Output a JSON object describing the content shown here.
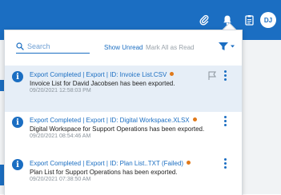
{
  "header": {
    "user_initials": "DJ",
    "icons": [
      "paperclip-icon",
      "bell-icon",
      "clipboard-icon"
    ]
  },
  "notifications_panel": {
    "search": {
      "placeholder": "Search",
      "value": ""
    },
    "show_unread_label": "Show Unread",
    "mark_all_read_label": "Mark All as Read",
    "filter_icon": "filter-icon",
    "items": [
      {
        "title": "Export Completed | Export | ID: Invoice List.CSV",
        "message": "Invoice List for David Jacobsen has been exported.",
        "timestamp": "09/20/2021 12:58:03 PM",
        "unread": true,
        "selected": true
      },
      {
        "title": "Export Completed | Export | ID: Digital Workspace.XLSX",
        "message": "Digital Workspace for Support Operations has been exported.",
        "timestamp": "09/20/2021 08:54:46 AM",
        "unread": true,
        "selected": false
      },
      {
        "title": "Export Completed | Export | ID: Plan List..TXT (Failed)",
        "message": "Plan List for Support Operations has been exported.",
        "timestamp": "09/20/2021 07:38:50 AM",
        "unread": true,
        "selected": false
      }
    ]
  },
  "colors": {
    "brand": "#1b6ec2",
    "unread_dot": "#e0791a",
    "selected_bg": "#e6eef7"
  }
}
